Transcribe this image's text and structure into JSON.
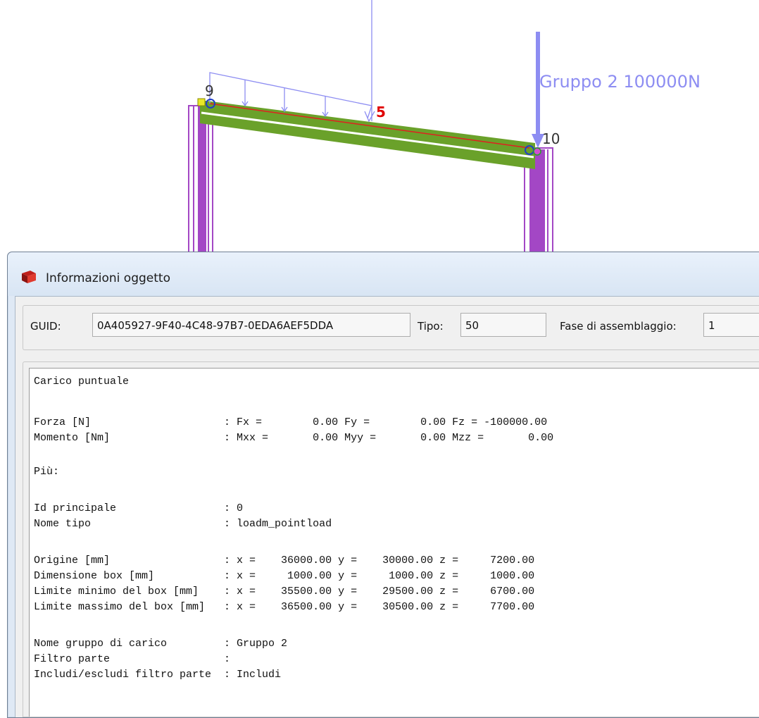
{
  "viewport": {
    "node_labels": [
      "9",
      "10"
    ],
    "load_number_label": "5",
    "point_load_label": "Gruppo 2 100000N",
    "colors": {
      "beam": "#6aa12a",
      "column": "#a347c5",
      "load": "#8d8df2",
      "axis_line": "#e02020",
      "load_number": "#e00000"
    }
  },
  "dialog": {
    "title": "Informazioni oggetto",
    "icon": "red-book-icon",
    "guid_label": "GUID:",
    "guid_value": "0A405927-9F40-4C48-97B7-0EDA6AEF5DDA",
    "tipo_label": "Tipo:",
    "tipo_value": "50",
    "fase_label": "Fase di assemblaggio:",
    "fase_value": "1",
    "lines": [
      "Carico puntuale",
      "",
      "Forza [N]                     : Fx =        0.00 Fy =        0.00 Fz = -100000.00",
      "Momento [Nm]                  : Mxx =       0.00 Myy =       0.00 Mzz =       0.00",
      "",
      "Più:",
      "",
      "Id principale                 : 0",
      "Nome tipo                     : loadm_pointload",
      "",
      "Origine [mm]                  : x =    36000.00 y =    30000.00 z =     7200.00",
      "Dimensione box [mm]           : x =     1000.00 y =     1000.00 z =     1000.00",
      "Limite minimo del box [mm]    : x =    35500.00 y =    29500.00 z =     6700.00",
      "Limite massimo del box [mm]   : x =    36500.00 y =    30500.00 z =     7700.00",
      "",
      "Nome gruppo di carico         : Gruppo 2",
      "Filtro parte                  :",
      "Includi/escludi filtro parte  : Includi"
    ]
  }
}
